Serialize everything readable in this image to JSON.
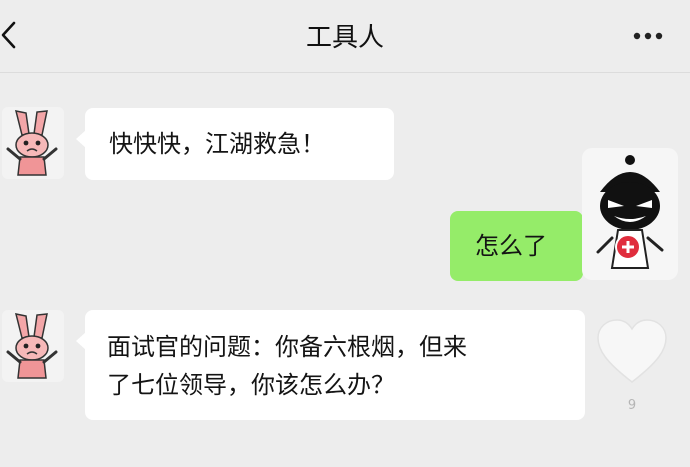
{
  "header": {
    "title": "工具人",
    "back_icon": "chevron-left-icon",
    "more_icon": "more-dots-icon"
  },
  "messages": [
    {
      "direction": "incoming",
      "sender_avatar": "bunny-avatar",
      "text": "快快快，江湖救急！"
    },
    {
      "direction": "outgoing",
      "sender_avatar": "cartoon-face-avatar",
      "text": "怎么了"
    },
    {
      "direction": "incoming",
      "sender_avatar": "bunny-avatar",
      "lines": [
        "面试官的问题：你备六根烟，但来",
        "了七位领导，你该怎么办？"
      ]
    }
  ],
  "side_actions": {
    "like_icon": "heart-icon",
    "like_count": "9"
  },
  "colors": {
    "background": "#ededed",
    "incoming_bubble": "#ffffff",
    "outgoing_bubble": "#95ec69",
    "badge_red": "#e02d3d"
  }
}
